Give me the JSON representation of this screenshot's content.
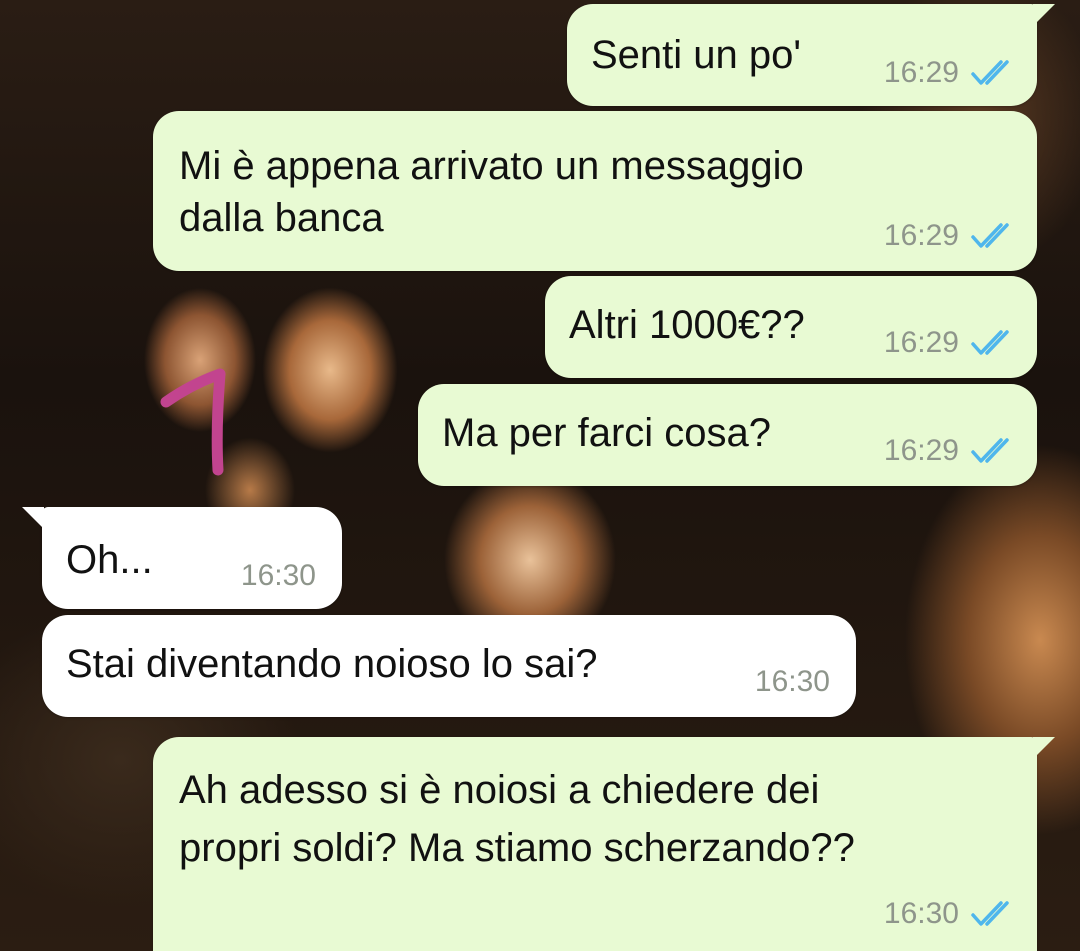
{
  "colors": {
    "outgoing_bubble": "#e8fad3",
    "incoming_bubble": "#ffffff",
    "timestamp": "#8e958b",
    "read_ticks": "#4fb6ec",
    "annotation_stroke": "#c2448f"
  },
  "messages": [
    {
      "direction": "outgoing",
      "lines": [
        "Senti un po'"
      ],
      "time": "16:29",
      "status_icon": "double-check-read-icon"
    },
    {
      "direction": "outgoing",
      "lines": [
        "Mi è appena arrivato un messaggio",
        "dalla banca"
      ],
      "time": "16:29",
      "status_icon": "double-check-read-icon"
    },
    {
      "direction": "outgoing",
      "lines": [
        "Altri 1000€??"
      ],
      "time": "16:29",
      "status_icon": "double-check-read-icon"
    },
    {
      "direction": "outgoing",
      "lines": [
        "Ma per farci cosa?"
      ],
      "time": "16:29",
      "status_icon": "double-check-read-icon"
    },
    {
      "direction": "incoming",
      "lines": [
        "Oh..."
      ],
      "time": "16:30"
    },
    {
      "direction": "incoming",
      "lines": [
        "Stai diventando noioso lo sai?"
      ],
      "time": "16:30"
    },
    {
      "direction": "outgoing",
      "lines": [
        "Ah adesso si è noiosi a chiedere dei",
        "propri soldi? Ma stiamo scherzando??"
      ],
      "time": "16:30",
      "status_icon": "double-check-read-icon"
    }
  ]
}
